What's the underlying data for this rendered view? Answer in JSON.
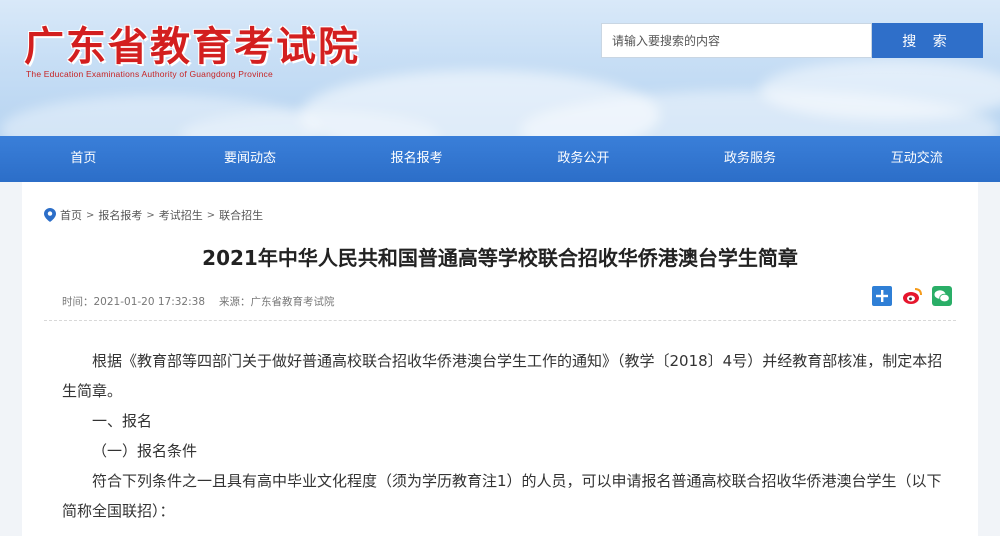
{
  "header": {
    "title": "广东省教育考试院",
    "subtitle": "The Education Examinations Authority of Guangdong Province",
    "search_placeholder": "请输入要搜索的内容",
    "search_button": "搜 索"
  },
  "nav": {
    "items": [
      "首页",
      "要闻动态",
      "报名报考",
      "政务公开",
      "政务服务",
      "互动交流"
    ]
  },
  "breadcrumb": [
    "首页",
    "报名报考",
    "考试招生",
    "联合招生"
  ],
  "article": {
    "title": "2021年中华人民共和国普通高等学校联合招收华侨港澳台学生简章",
    "time": "时间：2021-01-20 17:32:38",
    "source": "来源：广东省教育考试院",
    "paragraphs": [
      "根据《教育部等四部门关于做好普通高校联合招收华侨港澳台学生工作的通知》（教学〔2018〕4号）并经教育部核准，制定本招生简章。",
      "一、报名",
      "（一）报名条件",
      "符合下列条件之一且具有高中毕业文化程度（须为学历教育注1）的人员，可以申请报名普通高校联合招收华侨港澳台学生（以下简称全国联招）："
    ]
  },
  "colors": {
    "brand_red": "#d31f1f",
    "nav_blue": "#2c6ec8",
    "search_blue": "#2f6fc9"
  },
  "icons": {
    "breadcrumb": "location-pin-icon",
    "share": [
      "plus-share-icon",
      "weibo-icon",
      "wechat-icon"
    ]
  }
}
